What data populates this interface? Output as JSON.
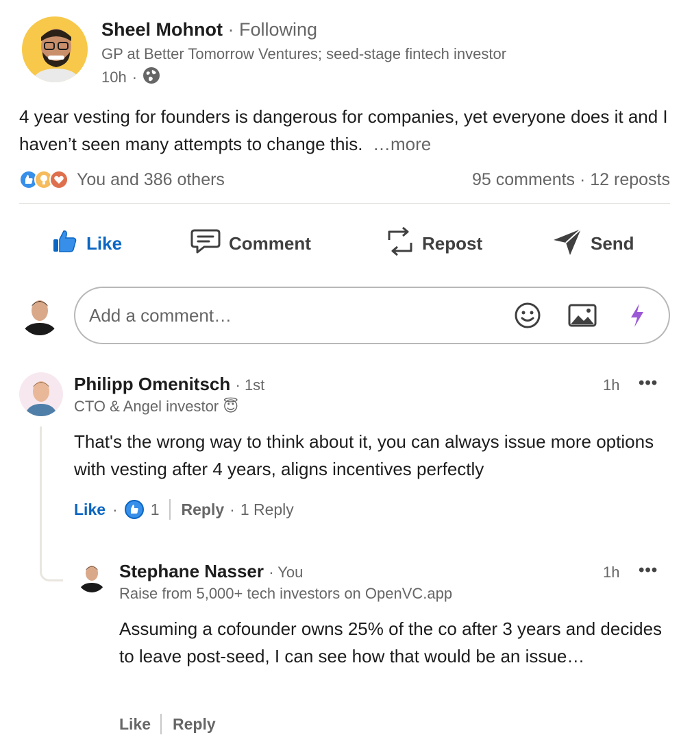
{
  "post": {
    "author_name": "Sheel Mohnot",
    "follow_status": "Following",
    "headline": "GP at Better Tomorrow Ventures; seed-stage fintech investor",
    "time": "10h",
    "text": "4 year vesting for founders is dangerous for companies, yet everyone does it and I haven’t seen many attempts to change this.",
    "more_label": "…more",
    "reactions_text": "You and 386 others",
    "comments_reposts": "95 comments · 12 reposts",
    "icons": [
      "globe-icon",
      "like-reaction-icon",
      "insightful-reaction-icon",
      "love-reaction-icon"
    ]
  },
  "actions": {
    "like": "Like",
    "comment": "Comment",
    "repost": "Repost",
    "send": "Send"
  },
  "comment_box": {
    "placeholder": "Add a comment…"
  },
  "comments": [
    {
      "name": "Philipp Omenitsch",
      "degree": "1st",
      "headline": "CTO & Angel investor 😇",
      "time": "1h",
      "text": "That's the wrong way to think about it, you can always issue more options with vesting after 4 years, aligns incentives perfectly",
      "like_label": "Like",
      "like_count": "1",
      "reply_label": "Reply",
      "replies_label": "1 Reply"
    },
    {
      "name": "Stephane Nasser",
      "degree": "You",
      "headline": "Raise from 5,000+ tech investors on OpenVC.app",
      "time": "1h",
      "text": "Assuming a cofounder owns 25% of the co after 3 years and decides to leave post-seed, I can see how that would be an issue…",
      "like_label": "Like",
      "reply_label": "Reply"
    }
  ],
  "colors": {
    "accent": "#0a66c2",
    "avatar_yellow": "#f7c84a",
    "text_secondary": "#666666"
  }
}
